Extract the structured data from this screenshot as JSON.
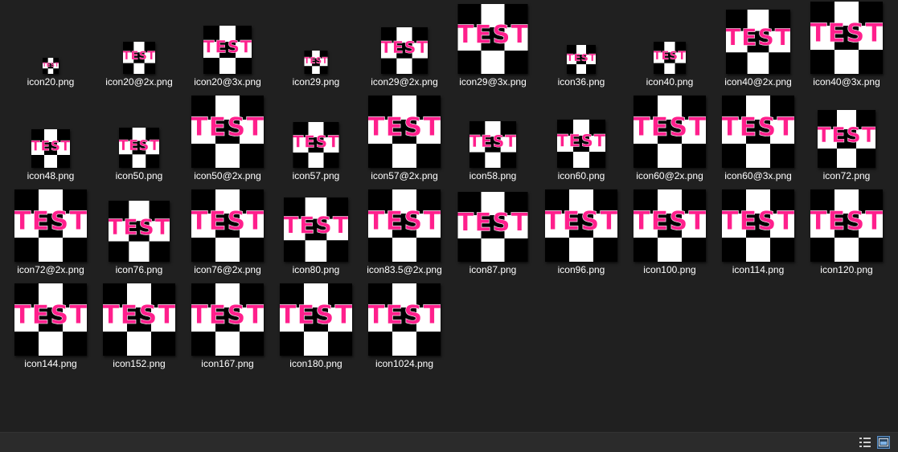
{
  "icon_art": {
    "text": "TEST",
    "colors": {
      "black": "#000000",
      "white": "#ffffff",
      "pink": "#ff1f8c"
    }
  },
  "files": [
    {
      "name": "icon20.png",
      "size": 20
    },
    {
      "name": "icon20@2x.png",
      "size": 40
    },
    {
      "name": "icon20@3x.png",
      "size": 60
    },
    {
      "name": "icon29.png",
      "size": 29
    },
    {
      "name": "icon29@2x.png",
      "size": 58
    },
    {
      "name": "icon29@3x.png",
      "size": 87
    },
    {
      "name": "icon36.png",
      "size": 36
    },
    {
      "name": "icon40.png",
      "size": 40
    },
    {
      "name": "icon40@2x.png",
      "size": 80
    },
    {
      "name": "icon40@3x.png",
      "size": 120
    },
    {
      "name": "icon48.png",
      "size": 48
    },
    {
      "name": "icon50.png",
      "size": 50
    },
    {
      "name": "icon50@2x.png",
      "size": 100
    },
    {
      "name": "icon57.png",
      "size": 57
    },
    {
      "name": "icon57@2x.png",
      "size": 114
    },
    {
      "name": "icon58.png",
      "size": 58
    },
    {
      "name": "icon60.png",
      "size": 60
    },
    {
      "name": "icon60@2x.png",
      "size": 120
    },
    {
      "name": "icon60@3x.png",
      "size": 180
    },
    {
      "name": "icon72.png",
      "size": 72
    },
    {
      "name": "icon72@2x.png",
      "size": 144
    },
    {
      "name": "icon76.png",
      "size": 76
    },
    {
      "name": "icon76@2x.png",
      "size": 152
    },
    {
      "name": "icon80.png",
      "size": 80
    },
    {
      "name": "icon83.5@2x.png",
      "size": 167
    },
    {
      "name": "icon87.png",
      "size": 87
    },
    {
      "name": "icon96.png",
      "size": 96
    },
    {
      "name": "icon100.png",
      "size": 100
    },
    {
      "name": "icon114.png",
      "size": 114
    },
    {
      "name": "icon120.png",
      "size": 120
    },
    {
      "name": "icon144.png",
      "size": 144
    },
    {
      "name": "icon152.png",
      "size": 152
    },
    {
      "name": "icon167.png",
      "size": 167
    },
    {
      "name": "icon180.png",
      "size": 180
    },
    {
      "name": "icon1024.png",
      "size": 1024
    }
  ],
  "statusbar": {
    "details_icon": "details-view-icon",
    "thumbnails_icon": "large-icons-view-icon"
  }
}
